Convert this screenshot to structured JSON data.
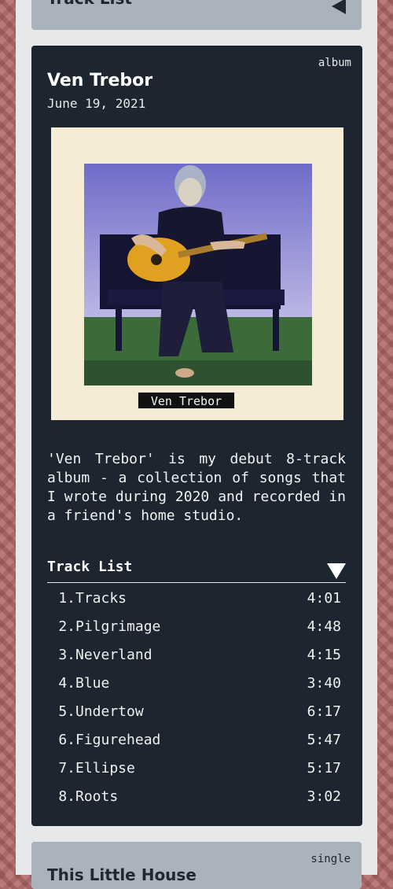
{
  "top_section": {
    "title": "Track List",
    "toggle_icon": "triangle-left-icon"
  },
  "album": {
    "type": "album",
    "title": "Ven Trebor",
    "date": "June 19, 2021",
    "cover_label": "Ven Trebor",
    "description": "'Ven Trebor' is my debut 8-track album - a collection of songs that I wrote during 2020 and recorded in a friend's home studio.",
    "tracklist_label": "Track List",
    "tracks": [
      {
        "number": "1.",
        "name": "Tracks",
        "duration": "4:01"
      },
      {
        "number": "2.",
        "name": "Pilgrimage",
        "duration": "4:48"
      },
      {
        "number": "3.",
        "name": "Neverland",
        "duration": "4:15"
      },
      {
        "number": "4.",
        "name": "Blue",
        "duration": "3:40"
      },
      {
        "number": "5.",
        "name": "Undertow",
        "duration": "6:17"
      },
      {
        "number": "6.",
        "name": "Figurehead",
        "duration": "5:47"
      },
      {
        "number": "7.",
        "name": "Ellipse",
        "duration": "5:17"
      },
      {
        "number": "8.",
        "name": "Roots",
        "duration": "3:02"
      }
    ]
  },
  "next_release": {
    "type": "single",
    "title": "This Little House"
  },
  "colors": {
    "card_dark": "#1d2630",
    "card_light": "#aab3bb",
    "cover_bg": "#f5ecd6"
  }
}
